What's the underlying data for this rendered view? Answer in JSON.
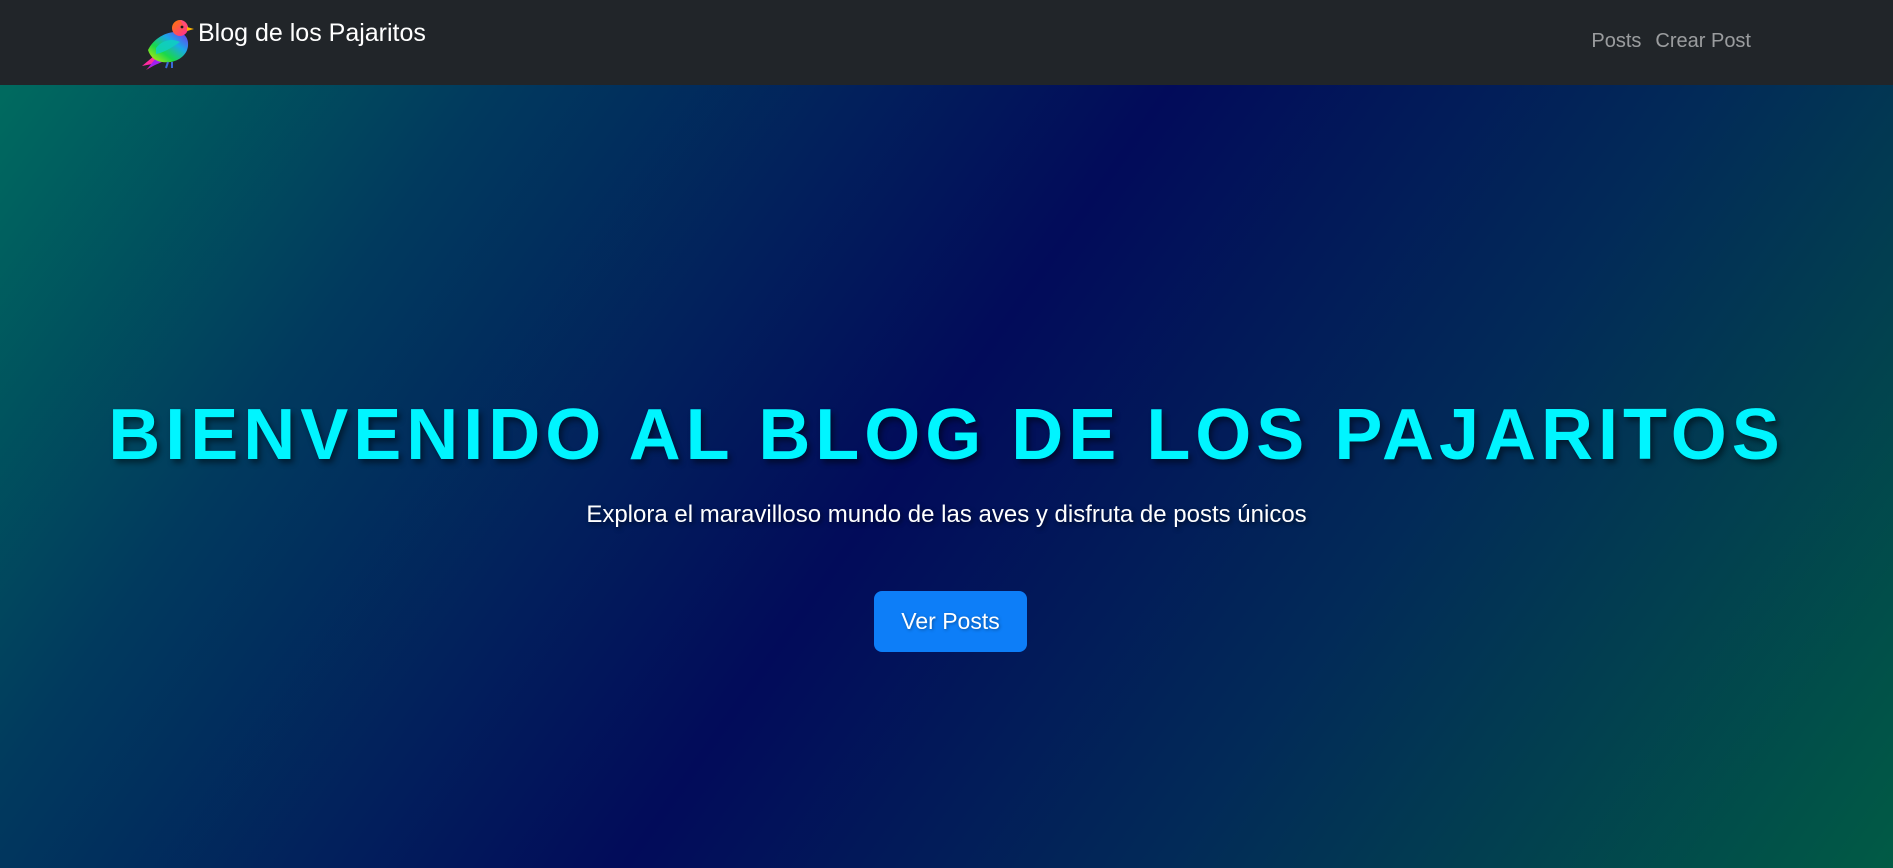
{
  "navbar": {
    "brand": {
      "logo_icon": "bird-logo-icon",
      "title": "Blog de los Pajaritos"
    },
    "links": [
      {
        "label": "Posts"
      },
      {
        "label": "Crear Post"
      }
    ],
    "background_color": "#212529"
  },
  "hero": {
    "title": "BIENVENIDO AL BLOG DE LOS PAJARITOS",
    "subtitle": "Explora el maravilloso mundo de las aves y disfruta de posts únicos",
    "button_label": "Ver Posts",
    "title_color": "#00f5ff",
    "button_color": "#0d7ef8"
  }
}
